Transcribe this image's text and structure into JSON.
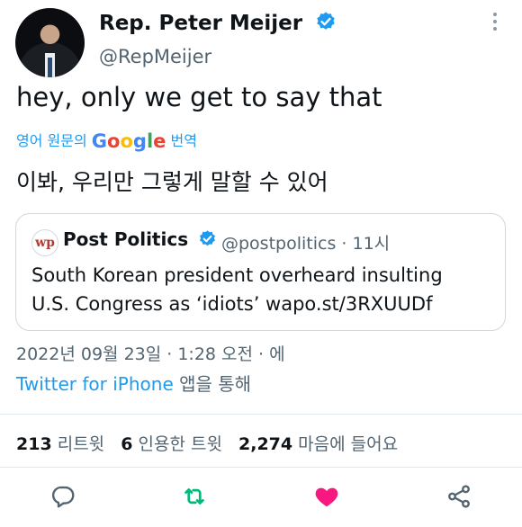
{
  "author": {
    "name": "Rep. Peter Meijer",
    "handle": "@RepMeijer"
  },
  "tweet": {
    "text": "hey, only we get to say that",
    "translate_prefix": "영어 원문의",
    "translate_google": [
      "G",
      "o",
      "o",
      "g",
      "l",
      "e"
    ],
    "translate_suffix": "번역",
    "translated_text": "이봐, 우리만 그렇게 말할 수 있어"
  },
  "quote": {
    "avatar_text": "wp",
    "name": "Post Politics",
    "handle": "@postpolitics",
    "separator": "·",
    "time": "11시",
    "text_line1": "South Korean president overheard insulting",
    "text_line2": "U.S. Congress as ‘idiots’ wapo.st/3RXUUDf"
  },
  "meta": {
    "datetime": "2022년 09월 23일 · 1:28 오전 · 에",
    "source": "Twitter for iPhone",
    "via": "앱을 통해"
  },
  "stats": {
    "retweets_count": "213",
    "retweets_label": "리트윗",
    "quotes_count": "6",
    "quotes_label": "인용한 트윗",
    "likes_count": "2,274",
    "likes_label": "마음에 들어요"
  },
  "colors": {
    "accent": "#1d9bf0",
    "retweet_green": "#00ba7c",
    "like_pink": "#f91880",
    "text_primary": "#0f1419",
    "text_secondary": "#536471"
  },
  "icons": {
    "verified": "verified-badge-icon",
    "more": "more-vertical-icon",
    "reply": "reply-icon",
    "retweet": "retweet-icon",
    "like": "heart-icon",
    "share": "share-icon"
  }
}
